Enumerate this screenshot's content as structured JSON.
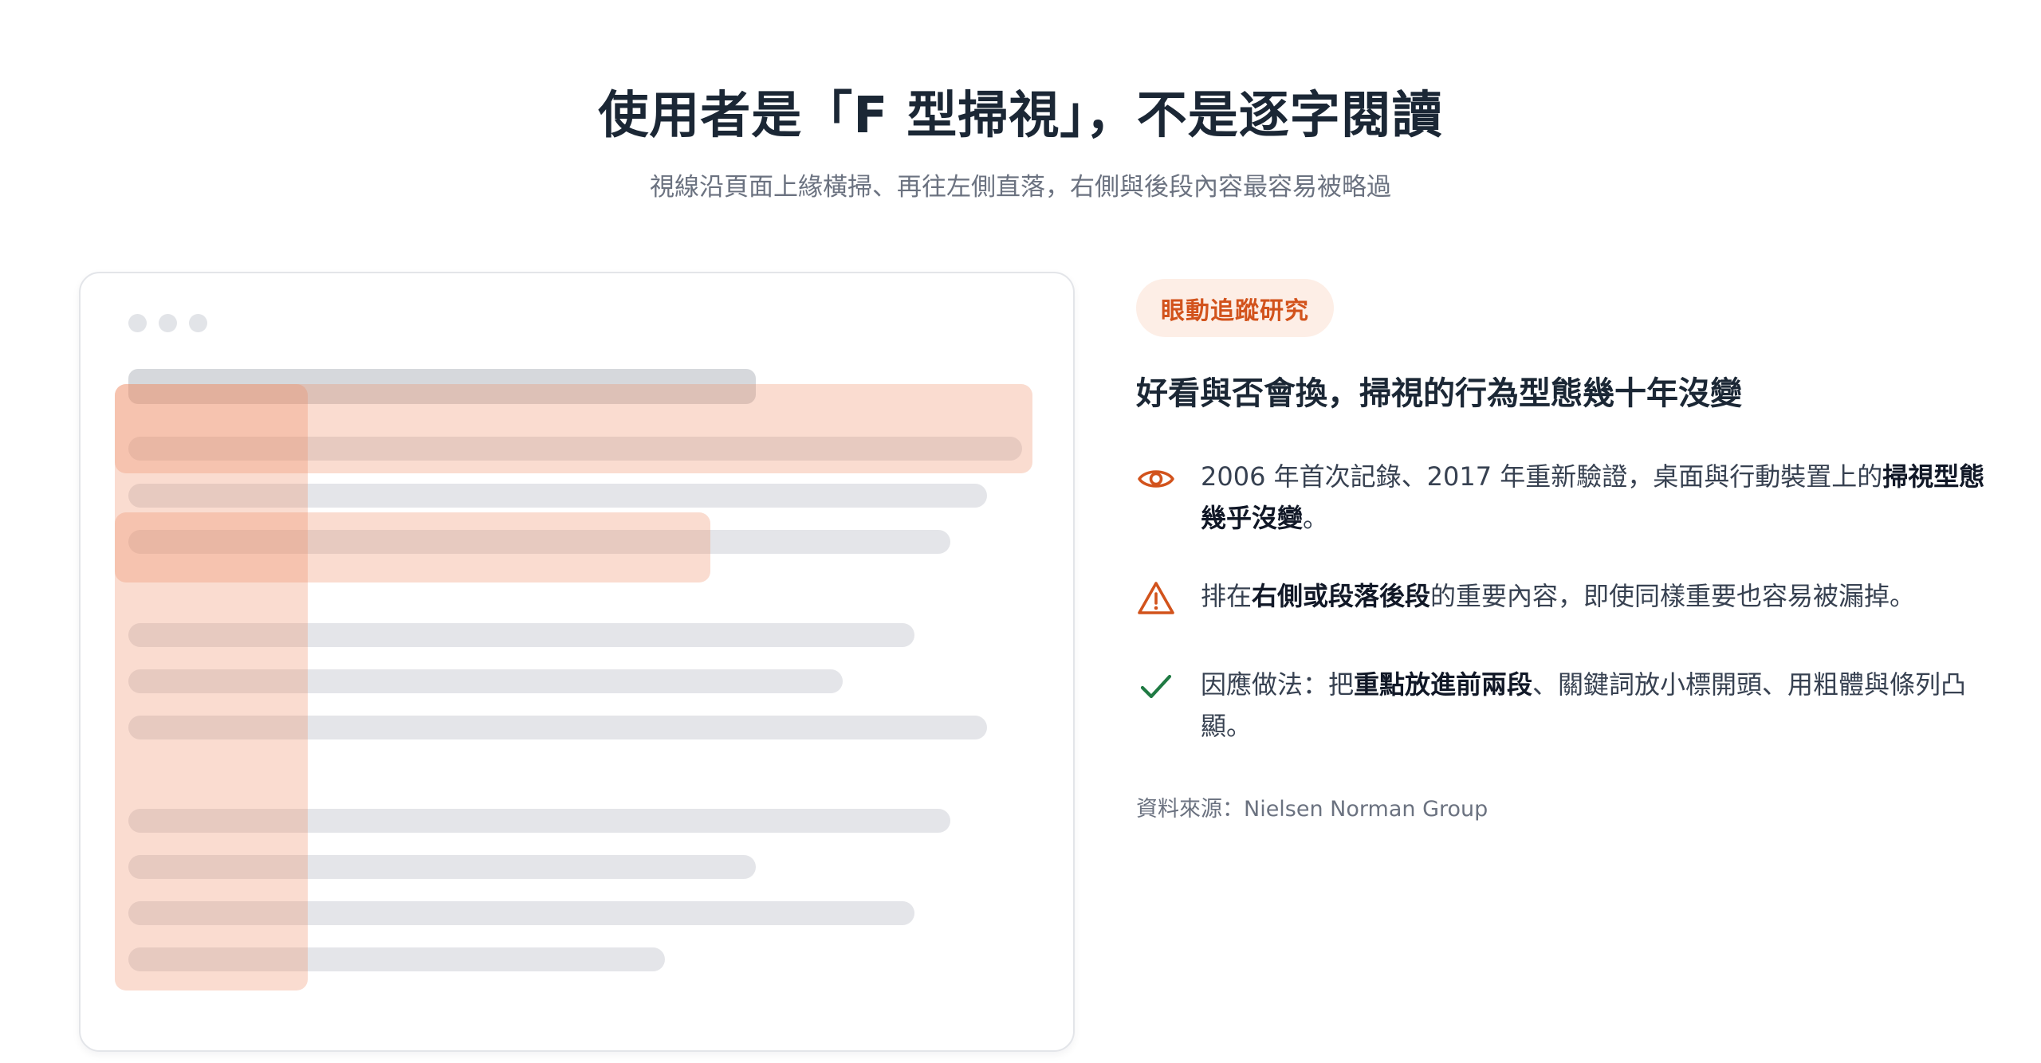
{
  "header": {
    "title": "使用者是「F 型掃視」，不是逐字閱讀",
    "subtitle": "視線沿頁面上緣橫掃、再往左側直落，右側與後段內容最容易被略過"
  },
  "panel": {
    "tag": "眼動追蹤研究",
    "heading": "好看與否會換，掃視的行為型態幾十年沒變",
    "points": [
      {
        "icon": "eye-icon",
        "parts": [
          "2006 年首次記錄、2017 年重新驗證，桌面與行動裝置上的",
          "掃視型態幾乎沒變",
          "。"
        ]
      },
      {
        "icon": "warning-icon",
        "parts": [
          "排在",
          "右側或段落後段",
          "的重要內容，即使同樣重要也容易被漏掉。"
        ]
      },
      {
        "icon": "check-icon",
        "parts": [
          "因應做法：把",
          "重點放進前兩段",
          "、關鍵詞放小標開頭、用粗體與條列凸顯。"
        ]
      }
    ],
    "source": "資料來源：Nielsen Norman Group"
  },
  "colors": {
    "accent": "#d2531c",
    "check": "#1f7a43",
    "heat": "#f08c64",
    "bar": "#e4e5e9"
  }
}
